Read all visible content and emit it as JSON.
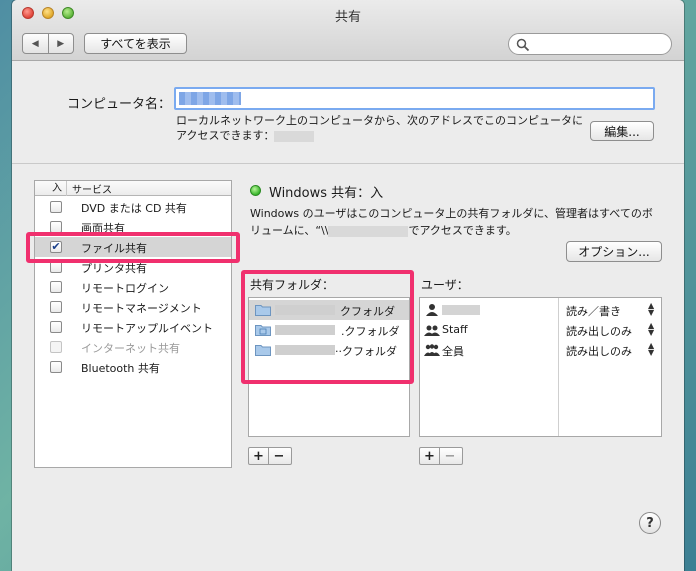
{
  "window": {
    "title": "共有"
  },
  "toolbar": {
    "back_glyph": "◀",
    "forward_glyph": "▶",
    "show_all_label": "すべてを表示",
    "search_placeholder": ""
  },
  "computer_name": {
    "label": "コンピュータ名：",
    "description_line1": "ローカルネットワーク上のコンピュータから、次のアドレスでこのコンピュータに",
    "description_line2_prefix": "アクセスできます：",
    "edit_button": "編集..."
  },
  "services": {
    "header_on": "入",
    "header_service": "サービス",
    "items": [
      {
        "label": "DVD または CD 共有",
        "checked": false,
        "enabled": true
      },
      {
        "label": "画面共有",
        "checked": false,
        "enabled": true
      },
      {
        "label": "ファイル共有",
        "checked": true,
        "enabled": true,
        "selected": true
      },
      {
        "label": "プリンタ共有",
        "checked": false,
        "enabled": true
      },
      {
        "label": "リモートログイン",
        "checked": false,
        "enabled": true
      },
      {
        "label": "リモートマネージメント",
        "checked": false,
        "enabled": true
      },
      {
        "label": "リモートアップルイベント",
        "checked": false,
        "enabled": true
      },
      {
        "label": "インターネット共有",
        "checked": false,
        "enabled": false
      },
      {
        "label": "Bluetooth 共有",
        "checked": false,
        "enabled": true
      }
    ]
  },
  "status": {
    "text": "Windows 共有：入",
    "color": "#37b52a"
  },
  "windows_desc": {
    "part1": "Windows のユーザはこのコンピュータ上の共有フォルダに、管理者はすべてのボ",
    "part2_prefix": "リュームに、“\\\\",
    "part2_suffix": "でアクセスできます。"
  },
  "options_button": "オプション...",
  "shared_folders": {
    "label": "共有フォルダ：",
    "items": [
      {
        "suffix": "クフォルダ"
      },
      {
        "suffix": ".クフォルダ"
      },
      {
        "suffix": "··クフォルダ"
      }
    ]
  },
  "users": {
    "label": "ユーザ：",
    "items": [
      {
        "name": "",
        "permission": "読み／書き"
      },
      {
        "name": "Staff",
        "permission": "読み出しのみ"
      },
      {
        "name": "全員",
        "permission": "読み出しのみ"
      }
    ]
  },
  "plus_minus": {
    "plus": "+",
    "minus": "−"
  },
  "help_glyph": "?",
  "colors": {
    "highlight": "#f0306e",
    "focus_ring": "#7aaaf0"
  }
}
